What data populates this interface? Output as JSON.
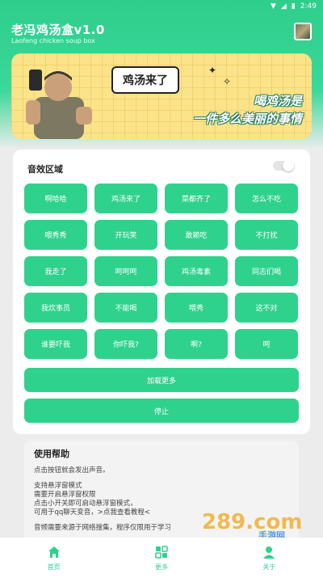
{
  "status_bar": {
    "time": "2:49"
  },
  "header": {
    "title": "老冯鸡汤盒v1.0",
    "subtitle": "Laofeng chicken soup box"
  },
  "banner": {
    "bubble_text": "鸡汤来了",
    "slogan_line1": "喝鸡汤是",
    "slogan_line2": "一件多么美丽的事情"
  },
  "sound_panel": {
    "title": "音效区域",
    "buttons": [
      "啊哈哈",
      "鸡汤来了",
      "菜都齐了",
      "怎么不吃",
      "喂秀秀",
      "开玩笑",
      "敢赖吃",
      "不打扰",
      "我走了",
      "呵呵呵",
      "鸡汤毒素",
      "同志们喝",
      "我炊事员",
      "不能喝",
      "喂秀",
      "这不对",
      "谁要吓我",
      "你吓我?",
      "啊?",
      "呵"
    ],
    "load_more_label": "加载更多",
    "stop_label": "停止"
  },
  "help": {
    "title": "使用帮助",
    "line1": "点击按钮就会发出声音。",
    "line2": "支持悬浮窗模式",
    "line3": "需要开启悬浮窗权限",
    "line4": "点击小开关即可启动悬浮窗模式，",
    "line5": "可用于qq聊天变音，>点我查看教程<",
    "line6": "音频需要来源于网络搜集，程序仅限用于学习"
  },
  "watermark": {
    "text": "289.com",
    "sub": "手游网"
  },
  "bottom_nav": {
    "items": [
      {
        "label": "首页",
        "icon": "home-icon"
      },
      {
        "label": "更多",
        "icon": "grid-icon"
      },
      {
        "label": "关于",
        "icon": "person-icon"
      }
    ]
  },
  "colors": {
    "accent": "#2ed28c",
    "banner_bg": "#fbe38a"
  }
}
